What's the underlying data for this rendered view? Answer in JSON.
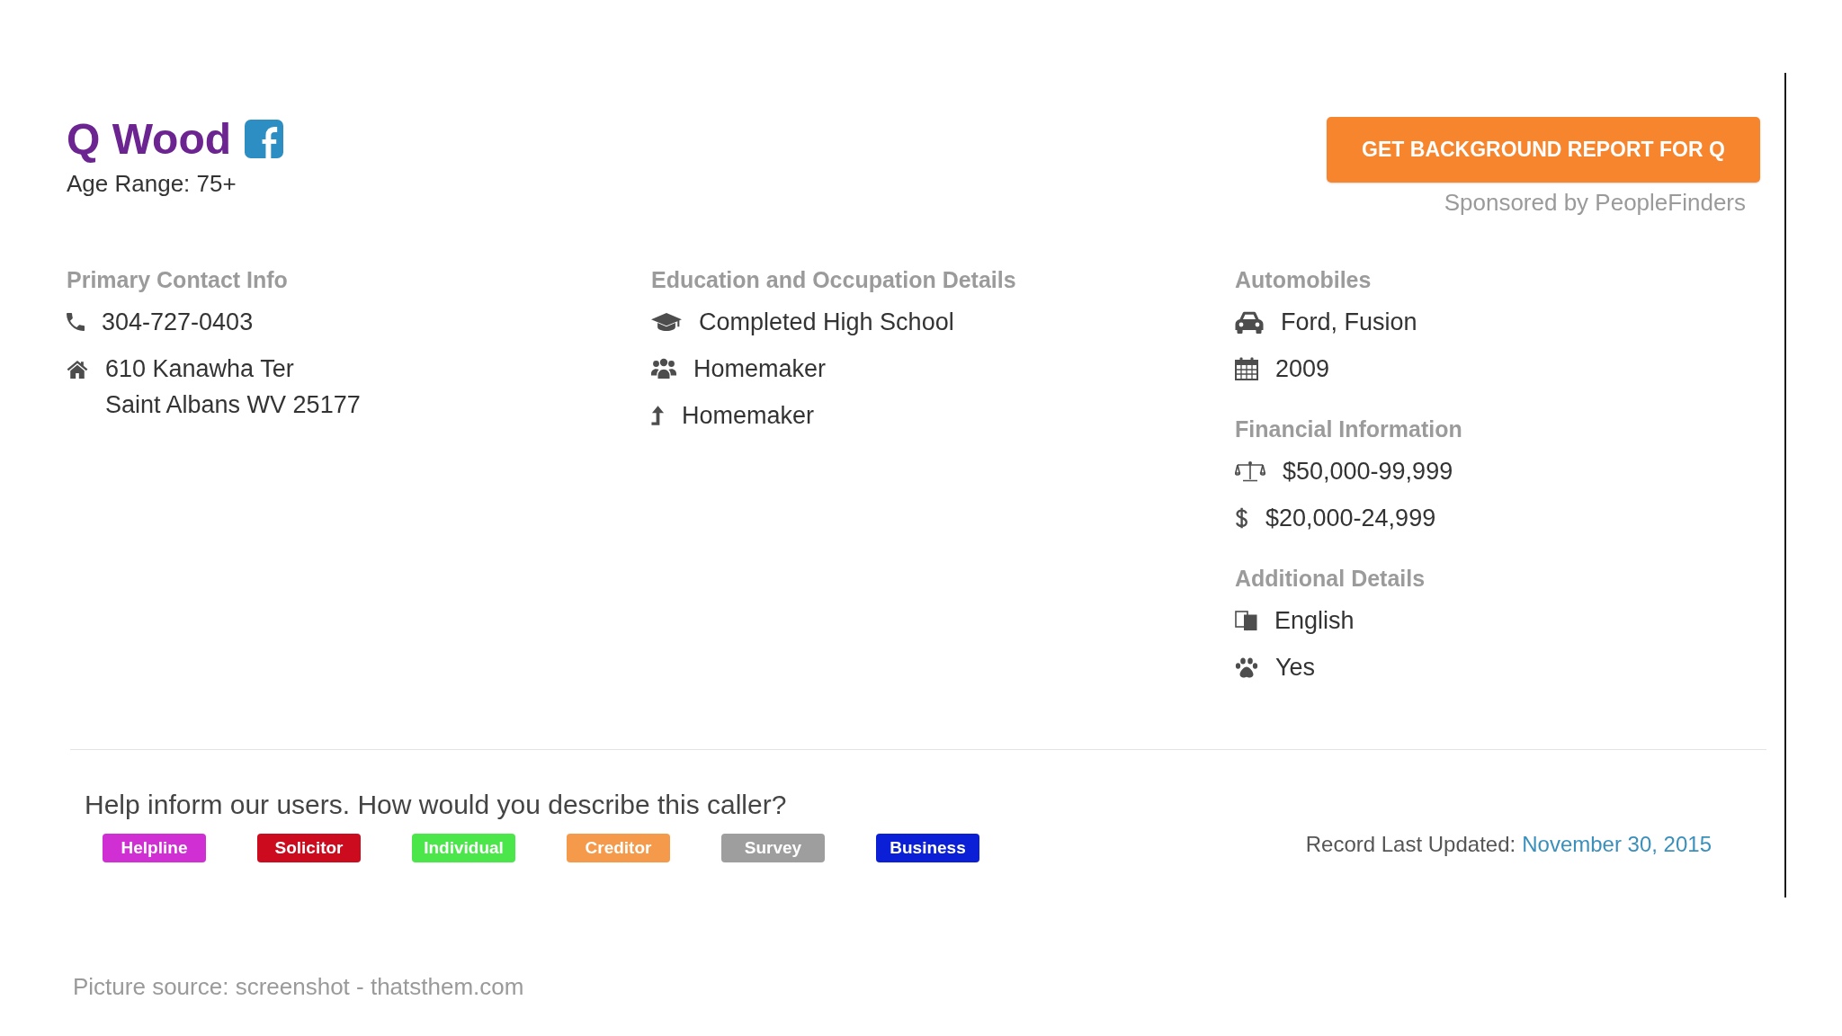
{
  "person": {
    "name": "Q Wood",
    "age_range": "Age Range: 75+"
  },
  "report_button": {
    "label": "GET BACKGROUND REPORT FOR Q"
  },
  "sponsor": "Sponsored by PeopleFinders",
  "columns": [
    {
      "sections": [
        {
          "title": "Primary Contact Info",
          "items": [
            {
              "kind": "phone",
              "lines": [
                "304-727-0403"
              ]
            },
            {
              "kind": "address",
              "lines": [
                "610 Kanawha Ter",
                "Saint Albans WV 25177"
              ]
            }
          ]
        }
      ]
    },
    {
      "sections": [
        {
          "title": "Education and Occupation Details",
          "items": [
            {
              "kind": "education",
              "lines": [
                "Completed High School"
              ]
            },
            {
              "kind": "occupation",
              "lines": [
                "Homemaker"
              ]
            },
            {
              "kind": "career",
              "lines": [
                "Homemaker"
              ]
            }
          ]
        }
      ]
    },
    {
      "sections": [
        {
          "title": "Automobiles",
          "items": [
            {
              "kind": "vehicle",
              "lines": [
                "Ford, Fusion"
              ]
            },
            {
              "kind": "year",
              "lines": [
                "2009"
              ]
            }
          ]
        },
        {
          "title": "Financial Information",
          "items": [
            {
              "kind": "wealth",
              "lines": [
                "$50,000-99,999"
              ]
            },
            {
              "kind": "income",
              "lines": [
                "$20,000-24,999"
              ]
            }
          ]
        },
        {
          "title": "Additional Details",
          "items": [
            {
              "kind": "language",
              "lines": [
                "English"
              ]
            },
            {
              "kind": "pets",
              "lines": [
                "Yes"
              ]
            }
          ]
        }
      ]
    }
  ],
  "feedback": {
    "prompt": "Help inform our users. How would you describe this caller?",
    "tags": [
      {
        "label": "Helpline",
        "color": "#cf2fd3"
      },
      {
        "label": "Solicitor",
        "color": "#cc0b1f"
      },
      {
        "label": "Individual",
        "color": "#4ae64a"
      },
      {
        "label": "Creditor",
        "color": "#f49a4a"
      },
      {
        "label": "Survey",
        "color": "#9e9e9e"
      },
      {
        "label": "Business",
        "color": "#0b20d6"
      }
    ]
  },
  "record_updated": {
    "label": "Record Last Updated:",
    "date": "November 30, 2015"
  },
  "caption": "Picture source: screenshot - thatsthem.com"
}
